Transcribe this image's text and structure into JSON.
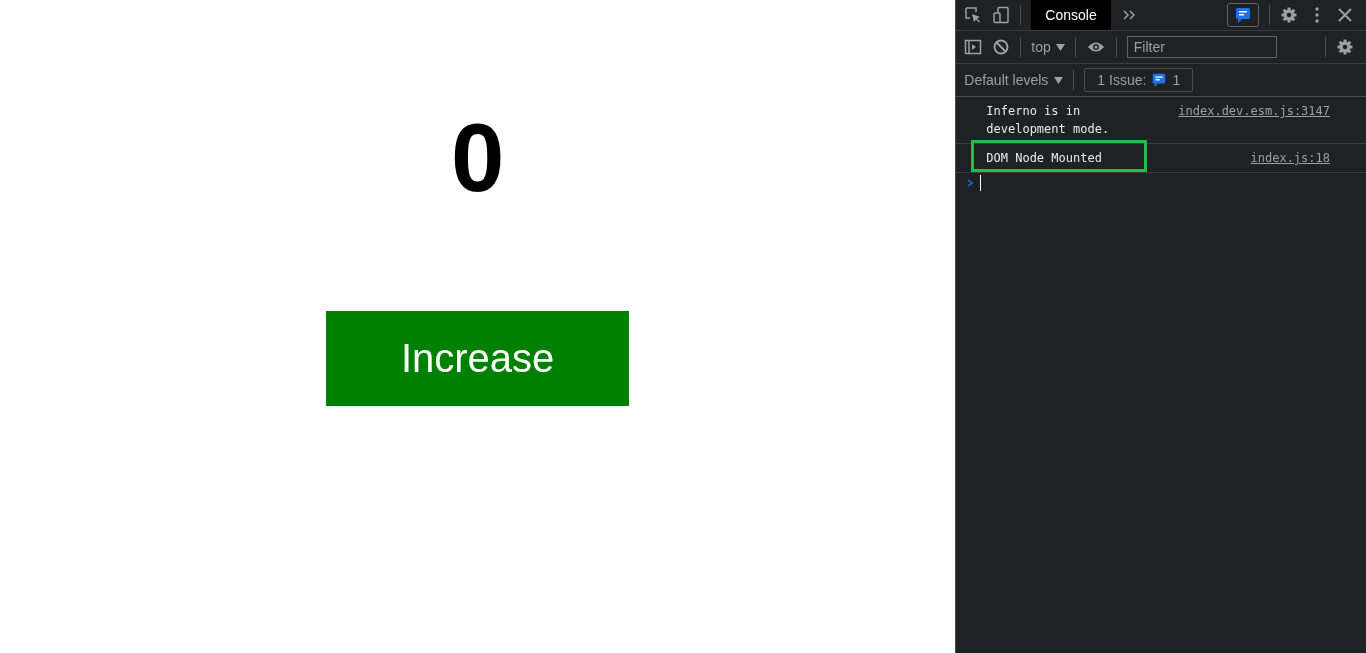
{
  "page": {
    "counter": "0",
    "button": "Increase"
  },
  "devtools": {
    "tabs": [
      {
        "label": "Console",
        "selected": true
      }
    ],
    "context": "top",
    "filter": {
      "placeholder": "Filter"
    },
    "levels": "Default levels",
    "issues": {
      "label": "1 Issue:",
      "count": "1"
    },
    "messages": [
      {
        "text": "Inferno is in development mode.",
        "source": "index.dev.esm.js:3147",
        "highlighted": false
      },
      {
        "text": "DOM Node Mounted",
        "source": "index.js:18",
        "highlighted": true
      }
    ]
  }
}
